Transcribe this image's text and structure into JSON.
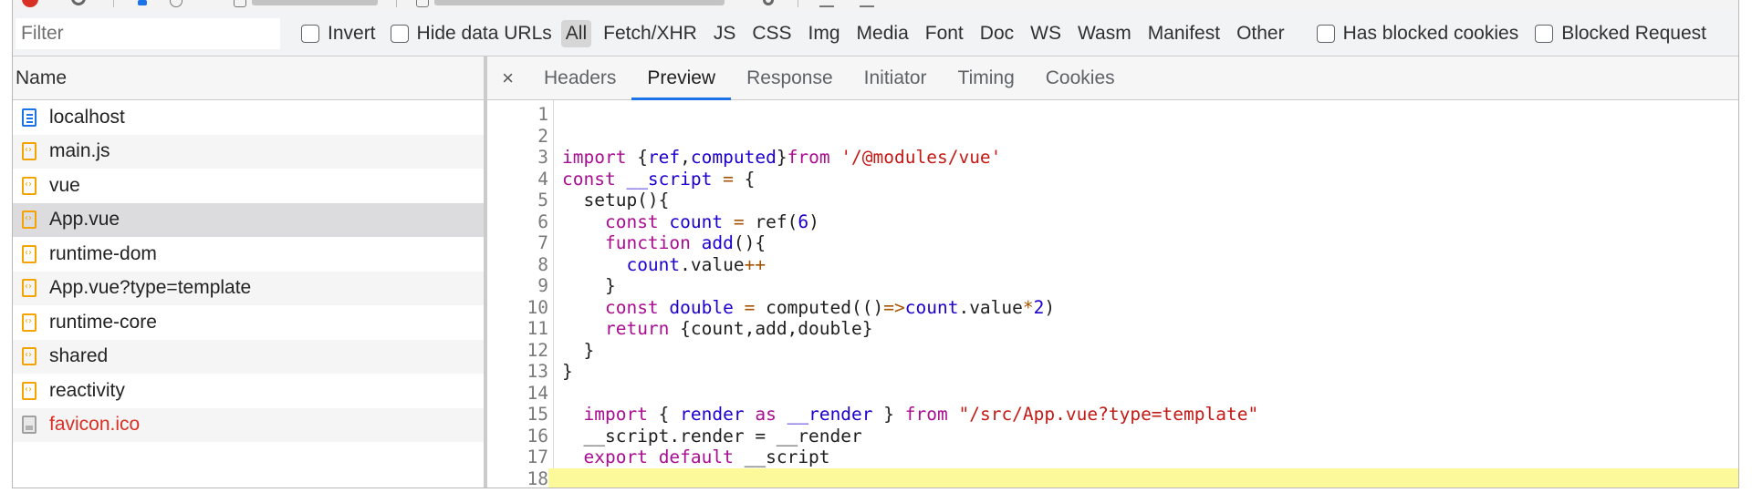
{
  "filter_bar": {
    "filter_placeholder": "Filter",
    "invert_label": "Invert",
    "hide_data_urls_label": "Hide data URLs",
    "type_buttons": [
      "All",
      "Fetch/XHR",
      "JS",
      "CSS",
      "Img",
      "Media",
      "Font",
      "Doc",
      "WS",
      "Wasm",
      "Manifest",
      "Other"
    ],
    "active_type": "All",
    "has_blocked_cookies_label": "Has blocked cookies",
    "blocked_requests_label": "Blocked Request"
  },
  "requests": {
    "header": "Name",
    "items": [
      {
        "name": "localhost",
        "icon": "document-icon"
      },
      {
        "name": "main.js",
        "icon": "script-icon"
      },
      {
        "name": "vue",
        "icon": "script-icon"
      },
      {
        "name": "App.vue",
        "icon": "script-icon",
        "selected": true
      },
      {
        "name": "runtime-dom",
        "icon": "script-icon"
      },
      {
        "name": "App.vue?type=template",
        "icon": "script-icon"
      },
      {
        "name": "runtime-core",
        "icon": "script-icon"
      },
      {
        "name": "shared",
        "icon": "script-icon"
      },
      {
        "name": "reactivity",
        "icon": "script-icon"
      },
      {
        "name": "favicon.ico",
        "icon": "image-icon",
        "error": true
      }
    ]
  },
  "details": {
    "close_glyph": "×",
    "tabs": [
      "Headers",
      "Preview",
      "Response",
      "Initiator",
      "Timing",
      "Cookies"
    ],
    "active_tab": "Preview"
  },
  "code": {
    "line_numbers": [
      "1",
      "2",
      "3",
      "4",
      "5",
      "6",
      "7",
      "8",
      "9",
      "10",
      "11",
      "12",
      "13",
      "14",
      "15",
      "16",
      "17",
      "18"
    ],
    "tokens": {
      "l3": [
        "import",
        " {",
        "ref",
        ",",
        "computed",
        "}",
        "from",
        " ",
        "'/@modules/vue'"
      ],
      "l4": [
        "const",
        " ",
        "__script",
        " ",
        "=",
        " {"
      ],
      "l5": [
        "  setup(){"
      ],
      "l6": [
        "    ",
        "const",
        " ",
        "count",
        " ",
        "=",
        " ref(",
        "6",
        ")"
      ],
      "l7": [
        "    ",
        "function",
        " ",
        "add",
        "(){"
      ],
      "l8": [
        "      ",
        "count",
        ".value",
        "++"
      ],
      "l9": [
        "    }"
      ],
      "l10": [
        "    ",
        "const",
        " ",
        "double",
        " ",
        "=",
        " computed(()",
        "=>",
        "count",
        ".value",
        "*",
        "2",
        ")"
      ],
      "l11": [
        "    ",
        "return",
        " {count,add,double}"
      ],
      "l12": [
        "  }"
      ],
      "l13": [
        "}"
      ],
      "l15": [
        "  ",
        "import",
        " { ",
        "render",
        " ",
        "as",
        " ",
        "__render",
        " } ",
        "from",
        " ",
        "\"/src/App.vue?type=template\""
      ],
      "l16": [
        "  __script.render = __render"
      ],
      "l17": [
        "  ",
        "export",
        " ",
        "default",
        " __script"
      ]
    }
  },
  "colors": {
    "accent": "#1a73e8",
    "keyword": "#aa0d91",
    "string": "#c41a16",
    "variable": "#1c00cf",
    "error_text": "#d93025",
    "highlight_line": "#fcf99b"
  }
}
